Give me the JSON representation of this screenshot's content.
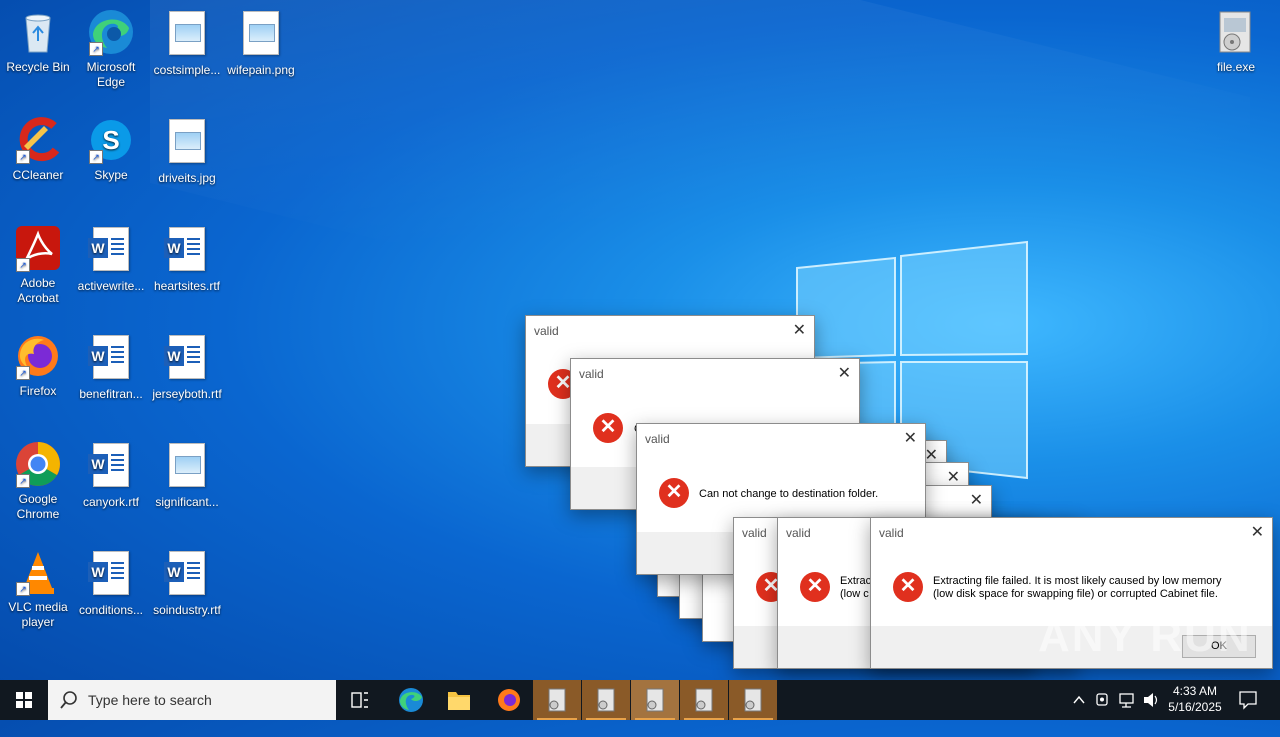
{
  "desktop": {
    "icons": [
      {
        "label": "Recycle Bin"
      },
      {
        "label": "Microsoft Edge"
      },
      {
        "label": "costsimple..."
      },
      {
        "label": "wifepain.png"
      },
      {
        "label": "CCleaner"
      },
      {
        "label": "Skype"
      },
      {
        "label": "driveits.jpg"
      },
      {
        "label": "Adobe Acrobat"
      },
      {
        "label": "activewrite..."
      },
      {
        "label": "heartsites.rtf"
      },
      {
        "label": "Firefox"
      },
      {
        "label": "benefitran..."
      },
      {
        "label": "jerseyboth.rtf"
      },
      {
        "label": "Google Chrome"
      },
      {
        "label": "canyork.rtf"
      },
      {
        "label": "significant..."
      },
      {
        "label": "VLC media player"
      },
      {
        "label": "conditions..."
      },
      {
        "label": "soindustry.rtf"
      },
      {
        "label": "file.exe"
      }
    ]
  },
  "dialogs": {
    "title": "valid",
    "close_glyph": "✕",
    "error_glyph": "✕",
    "msg_folder": "Can not change to destination folder.",
    "msg_c": "C",
    "msg_extract_partial_1": "Extrac",
    "msg_extract_partial_2": "(low c",
    "msg_extract_line1": "Extracting file failed.  It is most likely caused by low memory",
    "msg_extract_line2": "(low disk space for swapping file) or corrupted Cabinet file.",
    "ok_label": "OK"
  },
  "taskbar": {
    "search_placeholder": "Type here to search",
    "time": "4:33 AM",
    "date": "5/16/2025",
    "running_items": 5
  },
  "watermark": "ANY RUN",
  "colors": {
    "error_red": "#e0301e",
    "taskbar_bg": "#111820",
    "active_task": "#8a5a28"
  }
}
